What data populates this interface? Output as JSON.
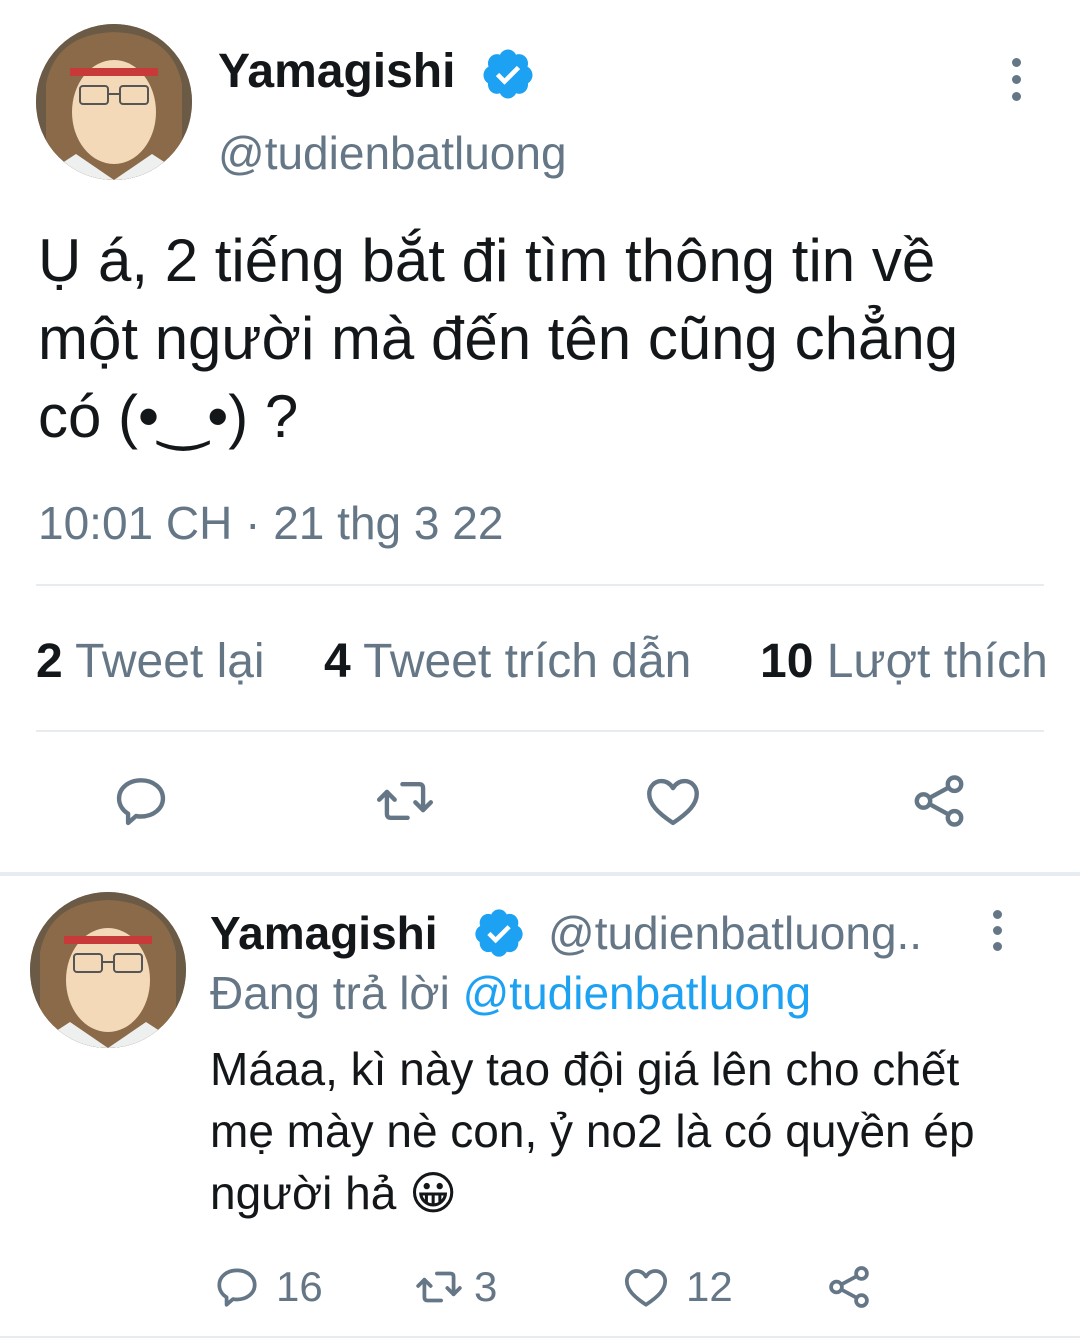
{
  "main_tweet": {
    "display_name": "Yamagishi",
    "handle": "@tudienbatluong",
    "text": "Ụ á,  2 tiếng bắt đi tìm thông tin về một người mà đến tên cũng chẳng có (•‿•) ?",
    "timestamp": "10:01 CH · 21 thg 3 22",
    "stats": {
      "retweets_count": "2",
      "retweets_label": "Tweet lại",
      "quotes_count": "4",
      "quotes_label": "Tweet trích dẫn",
      "likes_count": "10",
      "likes_label": "Lượt thích"
    },
    "actions": [
      "reply-icon",
      "retweet-icon",
      "like-icon",
      "share-icon"
    ]
  },
  "reply_tweet": {
    "display_name": "Yamagishi",
    "handle": "@tudienbatluong..",
    "replying_prefix": "Đang trả lời",
    "replying_to": "@tudienbatluong",
    "text": "Máaa, kì này tao đội giá lên cho chết mẹ mày nè con, ỷ no2 là có quyền ép người hả 😀",
    "reply_count": "16",
    "retweet_count": "3",
    "like_count": "12"
  },
  "colors": {
    "accent": "#1da1f2",
    "muted": "#657786",
    "text": "#14171a",
    "divider": "#e6ecf0"
  }
}
